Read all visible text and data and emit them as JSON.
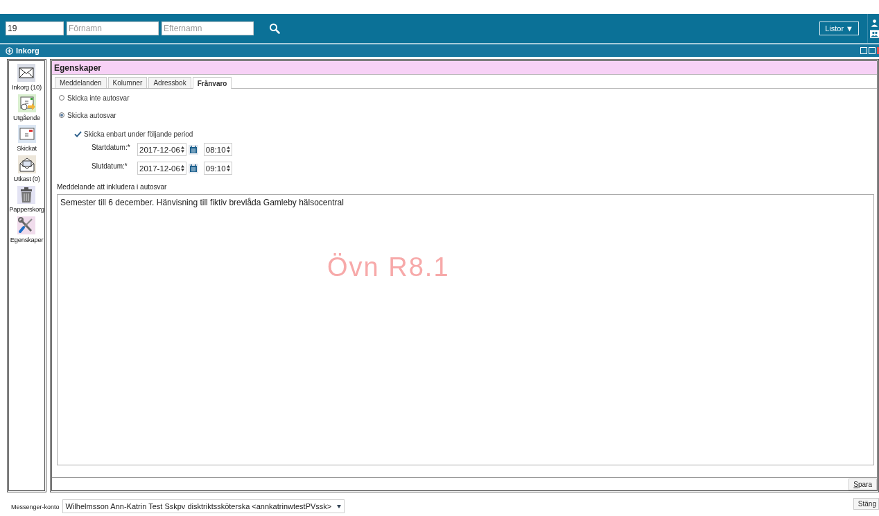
{
  "top_bar": {
    "id_field": {
      "value": "19"
    },
    "first_name_field": {
      "placeholder": "Förnamn"
    },
    "last_name_field": {
      "placeholder": "Efternamn"
    },
    "lists_button": {
      "label": "Listor",
      "caret": "▼"
    }
  },
  "module_bar": {
    "title": "Inkorg"
  },
  "sidebar": {
    "items": [
      {
        "label": "Inkorg (10)",
        "kind": "inbox"
      },
      {
        "label": "Utgående",
        "kind": "outbox"
      },
      {
        "label": "Skickat",
        "kind": "sent"
      },
      {
        "label": "Utkast (0)",
        "kind": "draft"
      },
      {
        "label": "Papperskorg",
        "kind": "trash"
      },
      {
        "label": "Egenskaper",
        "kind": "settings"
      }
    ]
  },
  "panel": {
    "title": "Egenskaper",
    "tabs": [
      {
        "label": "Meddelanden",
        "selected": false
      },
      {
        "label": "Kolumner",
        "selected": false
      },
      {
        "label": "Adressbok",
        "selected": false
      },
      {
        "label": "Frånvaro",
        "selected": true
      }
    ],
    "radios": [
      {
        "label": "Skicka inte autosvar",
        "selected": false
      },
      {
        "label": "Skicka autosvar",
        "selected": true
      }
    ],
    "period_checkbox": {
      "label": "Skicka enbart under följande period",
      "checked": true
    },
    "date_rows": [
      {
        "label": "Startdatum:*",
        "date": "2017-12-06",
        "time": "08:10"
      },
      {
        "label": "Slutdatum:*",
        "date": "2017-12-06",
        "time": "09:10"
      }
    ],
    "message_label": "Meddelande att inkludera i autosvar",
    "message": "Semester till 6 december. Hänvisning till fiktiv brevlåda Gamleby hälsocentral",
    "watermark": "Övn R8.1",
    "save_button": "Spara"
  },
  "footer": {
    "account_label": "Messenger-konto",
    "account_value": "Wilhelmsson Ann-Katrin Test Sskpv disktriktssköterska <annkatrinwtestPVssk>",
    "close_button": "Stäng"
  }
}
